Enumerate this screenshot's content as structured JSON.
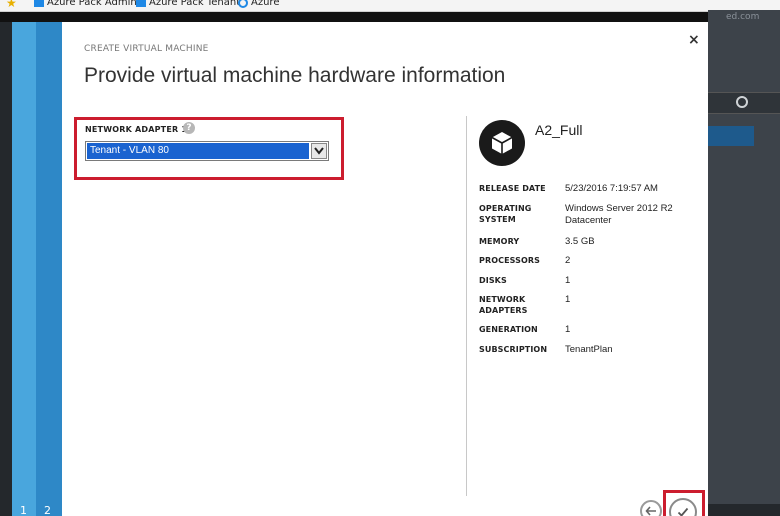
{
  "favorites": [
    {
      "label": "Azure Pack Admin",
      "icon": "windows-icon"
    },
    {
      "label": "Azure Pack Tenant",
      "icon": "windows-icon"
    },
    {
      "label": "Azure",
      "icon": "ie-icon"
    }
  ],
  "portal": {
    "domain_partial": "ed.com"
  },
  "wizard": {
    "steps": [
      "1",
      "2"
    ],
    "subtitle": "CREATE VIRTUAL MACHINE",
    "title": "Provide virtual machine hardware information",
    "close_label": "×"
  },
  "network": {
    "label": "NETWORK ADAPTER 1",
    "help": "?",
    "selected": "Tenant - VLAN 80"
  },
  "vm": {
    "name": "A2_Full",
    "properties": [
      {
        "key": "RELEASE DATE",
        "value": "5/23/2016 7:19:57 AM"
      },
      {
        "key": "OPERATING SYSTEM",
        "value": "Windows Server 2012 R2 Datacenter"
      },
      {
        "key": "MEMORY",
        "value": "3.5 GB"
      },
      {
        "key": "PROCESSORS",
        "value": "2"
      },
      {
        "key": "DISKS",
        "value": "1"
      },
      {
        "key": "NETWORK ADAPTERS",
        "value": "1"
      },
      {
        "key": "GENERATION",
        "value": "1"
      },
      {
        "key": "SUBSCRIPTION",
        "value": "TenantPlan"
      }
    ]
  },
  "colors": {
    "accent_blue": "#2e88c7",
    "highlight_red": "#cc1d2e",
    "selection_blue": "#1a63d0"
  }
}
